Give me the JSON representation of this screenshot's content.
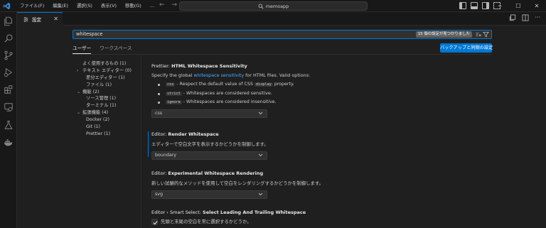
{
  "menu": [
    "ファイル(F)",
    "編集(E)",
    "選択(S)",
    "表示(V)",
    "移動(G)",
    "…"
  ],
  "command_center": "memoapp",
  "tab": {
    "label": "設定"
  },
  "search": {
    "value": "whitespace",
    "badge": "15 個の設定が見つかりました"
  },
  "scope_tabs": [
    "ユーザー",
    "ワークスペース"
  ],
  "sync_button": "バックアップと同期の設定",
  "toc": [
    {
      "label": "よく使用するもの (1)",
      "level": 1,
      "chev": ""
    },
    {
      "label": "テキスト エディター (0)",
      "level": 1,
      "chev": "›"
    },
    {
      "label": "差分エディター (1)",
      "level": 2,
      "chev": ""
    },
    {
      "label": "ファイル (1)",
      "level": 2,
      "chev": ""
    },
    {
      "label": "機能 (2)",
      "level": 1,
      "chev": "⌄"
    },
    {
      "label": "ソース管理 (1)",
      "level": 2,
      "chev": ""
    },
    {
      "label": "ターミナル (1)",
      "level": 2,
      "chev": ""
    },
    {
      "label": "拡張機能 (4)",
      "level": 1,
      "chev": "⌄"
    },
    {
      "label": "Docker (2)",
      "level": 2,
      "chev": ""
    },
    {
      "label": "Git (1)",
      "level": 2,
      "chev": ""
    },
    {
      "label": "Prettier (1)",
      "level": 2,
      "chev": ""
    }
  ],
  "settings": {
    "prettier": {
      "category": "Prettier: ",
      "key": "HTML Whitespace Sensitivity",
      "desc_pre": "Specify the global ",
      "desc_link": "whitespace sensitivity",
      "desc_post": " for HTML files. Valid options:",
      "bullets": [
        {
          "code": "css",
          "pre": " - Respect the default value of CSS ",
          "code2": "display",
          "post": " property."
        },
        {
          "code": "strict",
          "pre": " - Whitespaces are considered sensitive.",
          "code2": "",
          "post": ""
        },
        {
          "code": "ignore",
          "pre": " - Whitespaces are considered insensitive.",
          "code2": "",
          "post": ""
        }
      ],
      "value": "css"
    },
    "render_ws": {
      "category": "Editor: ",
      "key": "Render Whitespace",
      "desc": "エディターで空白文字を表示するかどうかを制御します。",
      "value": "boundary"
    },
    "exp_ws": {
      "category": "Editor: ",
      "key": "Experimental Whitespace Rendering",
      "desc": "新しい試験的なメソッドを使用して空白をレンダリングするかどうかを制御します。",
      "value": "svg"
    },
    "smart_select": {
      "category": "Editor › Smart Select: ",
      "key": "Select Leading And Trailing Whitespace",
      "desc": "先頭と末尾の空白を常に選択するかどうか。",
      "checked": true
    }
  },
  "colors": {
    "accent": "#0078d4",
    "link": "#4daafc",
    "background": "#1f1f1f"
  }
}
